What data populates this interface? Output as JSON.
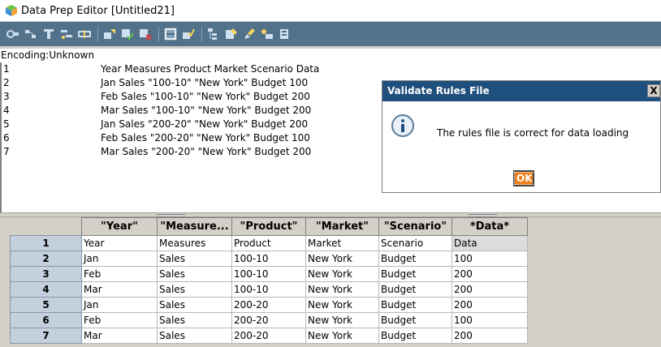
{
  "window": {
    "title": "Data Prep Editor [Untitled21]"
  },
  "toolbar": {
    "buttons": [
      {
        "icon": "field-properties-icon"
      },
      {
        "icon": "dimension-build-icon"
      },
      {
        "icon": "join-fields-icon"
      },
      {
        "icon": "create-field-icon"
      },
      {
        "icon": "split-field-icon"
      },
      {
        "icon": "move-field-icon"
      },
      {
        "icon": "select-record-icon"
      },
      {
        "icon": "reject-record-icon"
      },
      {
        "icon": "data-load-settings-icon"
      },
      {
        "icon": "validate-icon"
      },
      {
        "icon": "view-dimension-icon"
      },
      {
        "icon": "associate-outline-icon"
      },
      {
        "icon": "edit-rules-icon"
      },
      {
        "icon": "open-data-icon"
      },
      {
        "icon": "header-icon"
      }
    ]
  },
  "encoding": {
    "label": "Encoding:Unknown"
  },
  "text_lines": [
    {
      "num": "1",
      "text": "Year Measures Product Market Scenario Data"
    },
    {
      "num": "2",
      "text": "Jan Sales \"100-10\" \"New York\" Budget 100"
    },
    {
      "num": "3",
      "text": "Feb Sales \"100-10\" \"New York\" Budget 200"
    },
    {
      "num": "4",
      "text": "Mar Sales \"100-10\" \"New York\" Budget 200"
    },
    {
      "num": "5",
      "text": "Jan Sales \"200-20\" \"New York\" Budget 200"
    },
    {
      "num": "6",
      "text": "Feb Sales \"200-20\" \"New York\" Budget 100"
    },
    {
      "num": "7",
      "text": "Mar Sales \"200-20\" \"New York\" Budget 200"
    }
  ],
  "grid": {
    "columns": [
      "\"Year\"",
      "\"Measure...",
      "\"Product\"",
      "\"Market\"",
      "\"Scenario\"",
      "*Data*"
    ],
    "rows": [
      {
        "num": "1",
        "cells": [
          "Year",
          "Measures",
          "Product",
          "Market",
          "Scenario",
          "Data"
        ]
      },
      {
        "num": "2",
        "cells": [
          "Jan",
          "Sales",
          "100-10",
          "New York",
          "Budget",
          "100"
        ]
      },
      {
        "num": "3",
        "cells": [
          "Feb",
          "Sales",
          "100-10",
          "New York",
          "Budget",
          "200"
        ]
      },
      {
        "num": "4",
        "cells": [
          "Mar",
          "Sales",
          "100-10",
          "New York",
          "Budget",
          "200"
        ]
      },
      {
        "num": "5",
        "cells": [
          "Jan",
          "Sales",
          "200-20",
          "New York",
          "Budget",
          "200"
        ]
      },
      {
        "num": "6",
        "cells": [
          "Feb",
          "Sales",
          "200-20",
          "New York",
          "Budget",
          "100"
        ]
      },
      {
        "num": "7",
        "cells": [
          "Mar",
          "Sales",
          "200-20",
          "New York",
          "Budget",
          "200"
        ]
      }
    ]
  },
  "dialog": {
    "title": "Validate Rules File",
    "close": "X",
    "message": "The rules file is correct for data loading",
    "ok_label": "OK",
    "icon": "info-icon"
  },
  "colors": {
    "toolbar": "#52718a",
    "dialog_title": "#1f4f7c",
    "ok_button": "#f07f1c",
    "row_header": "#c4d0de"
  }
}
